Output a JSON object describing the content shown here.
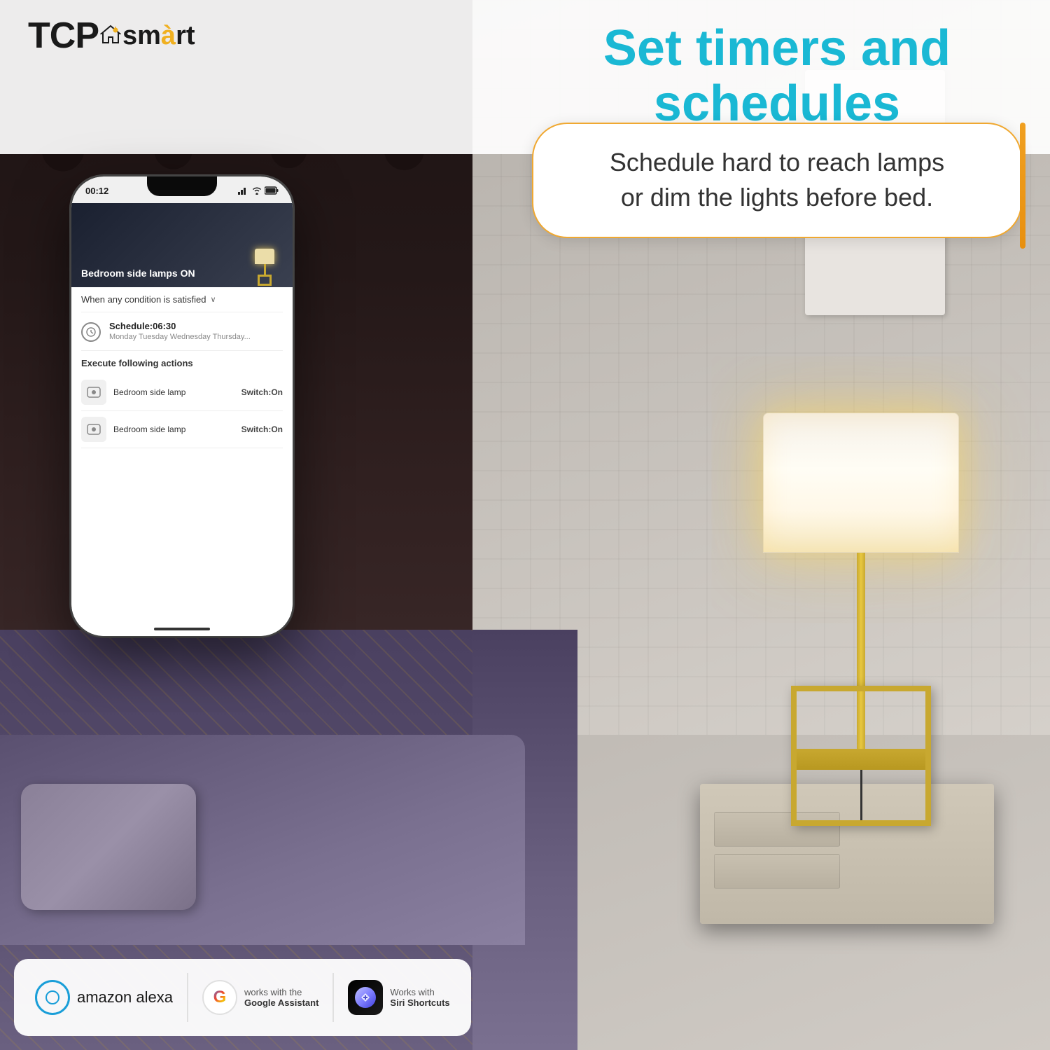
{
  "brand": {
    "tcp": "TCP",
    "smart": "smàrt",
    "logo_alt": "TCP Smart Logo"
  },
  "headline": {
    "title": "Set timers and schedules",
    "subtitle_line1": "Schedule hard to reach lamps",
    "subtitle_line2": "or dim the lights before bed."
  },
  "phone": {
    "status_time": "00:12",
    "app_header_text": "Bedroom side lamps ON",
    "condition_label": "When any condition is satisfied",
    "schedule_title": "Schedule:06:30",
    "schedule_days": "Monday Tuesday Wednesday Thursday...",
    "execute_label": "Execute following actions",
    "actions": [
      {
        "device_name": "Bedroom side lamp",
        "action": "Switch:On"
      },
      {
        "device_name": "Bedroom side lamp",
        "action": "Switch:On"
      }
    ]
  },
  "badges": {
    "alexa": {
      "text": "amazon alexa"
    },
    "google": {
      "works_with": "works with the",
      "product": "Google Assistant"
    },
    "siri": {
      "works_with": "Works with",
      "product": "Siri Shortcuts"
    }
  }
}
